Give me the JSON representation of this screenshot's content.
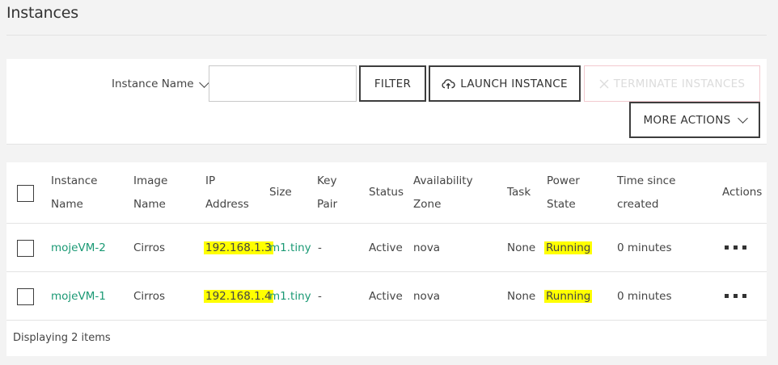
{
  "page": {
    "title": "Instances"
  },
  "toolbar": {
    "filter_field_label": "Instance Name",
    "filter_input_value": "",
    "filter_button": "FILTER",
    "launch_button": "LAUNCH INSTANCE",
    "terminate_button": "TERMINATE INSTANCES",
    "more_actions_button": "MORE ACTIONS"
  },
  "table": {
    "headers": {
      "instance_name": [
        "Instance",
        "Name"
      ],
      "image_name": [
        "Image",
        "Name"
      ],
      "ip_address": [
        "IP",
        "Address"
      ],
      "size": "Size",
      "key_pair": [
        "Key",
        "Pair"
      ],
      "status": "Status",
      "availability_zone": [
        "Availability",
        "Zone"
      ],
      "task": "Task",
      "power_state": [
        "Power",
        "State"
      ],
      "time_since_created": [
        "Time since",
        "created"
      ],
      "actions": "Actions"
    },
    "rows": [
      {
        "instance_name": "mojeVM-2",
        "image_name": "Cirros",
        "ip_address": "192.168.1.3",
        "size": "m1.tiny",
        "key_pair": "-",
        "status": "Active",
        "availability_zone": "nova",
        "task": "None",
        "power_state": "Running",
        "time_since_created": "0 minutes"
      },
      {
        "instance_name": "mojeVM-1",
        "image_name": "Cirros",
        "ip_address": "192.168.1.4",
        "size": "m1.tiny",
        "key_pair": "-",
        "status": "Active",
        "availability_zone": "nova",
        "task": "None",
        "power_state": "Running",
        "time_since_created": "0 minutes"
      }
    ],
    "footer": "Displaying 2 items"
  },
  "colors": {
    "link": "#1a9974",
    "highlight": "#ffff00",
    "terminate_disabled_border": "#f2c9cf"
  },
  "icons": [
    "chevron-down-icon",
    "cloud-upload-icon",
    "close-icon",
    "more-dots-icon"
  ]
}
